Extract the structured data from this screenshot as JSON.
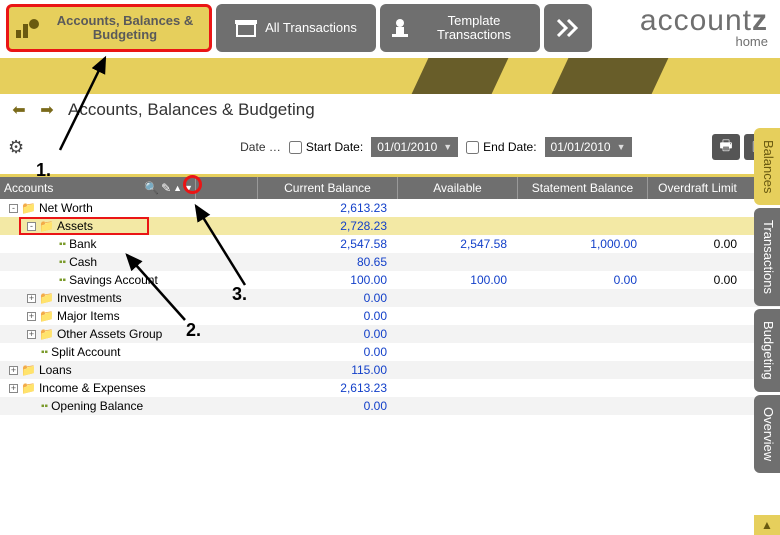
{
  "toolbar": {
    "accounts_label": "Accounts, Balances & Budgeting",
    "all_trans_label": "All Transactions",
    "template_trans_label": "Template Transactions"
  },
  "brand": {
    "name_a": "account",
    "name_b": "z",
    "sub": "home"
  },
  "page": {
    "title": "Accounts, Balances & Budgeting"
  },
  "filter": {
    "date_label": "Date …",
    "start_label": "Start Date:",
    "end_label": "End Date:",
    "start_value": "01/01/2010",
    "end_value": "01/01/2010"
  },
  "columns": {
    "tree": "Accounts",
    "current": "Current Balance",
    "available": "Available",
    "statement": "Statement Balance",
    "overdraft": "Overdraft Limit"
  },
  "rows": [
    {
      "indent": 0,
      "exp": "-",
      "icon": "folder",
      "label": "Net Worth",
      "cb": "2,613.23",
      "av": "",
      "sb": "",
      "ol": ""
    },
    {
      "indent": 1,
      "exp": "-",
      "icon": "folder",
      "label": "Assets",
      "cb": "2,728.23",
      "av": "",
      "sb": "",
      "ol": "",
      "selected": true,
      "boxed": true
    },
    {
      "indent": 2,
      "exp": "",
      "icon": "leaf",
      "label": "Bank",
      "cb": "2,547.58",
      "av": "2,547.58",
      "sb": "1,000.00",
      "ol": "0.00"
    },
    {
      "indent": 2,
      "exp": "",
      "icon": "leaf",
      "label": "Cash",
      "cb": "80.65",
      "av": "",
      "sb": "",
      "ol": ""
    },
    {
      "indent": 2,
      "exp": "",
      "icon": "leaf",
      "label": "Savings Account",
      "cb": "100.00",
      "av": "100.00",
      "sb": "0.00",
      "ol": "0.00"
    },
    {
      "indent": 1,
      "exp": "+",
      "icon": "folder",
      "label": "Investments",
      "cb": "0.00",
      "av": "",
      "sb": "",
      "ol": ""
    },
    {
      "indent": 1,
      "exp": "+",
      "icon": "folder",
      "label": "Major Items",
      "cb": "0.00",
      "av": "",
      "sb": "",
      "ol": ""
    },
    {
      "indent": 1,
      "exp": "+",
      "icon": "folder",
      "label": "Other Assets Group",
      "cb": "0.00",
      "av": "",
      "sb": "",
      "ol": ""
    },
    {
      "indent": 1,
      "exp": "",
      "icon": "leaf",
      "label": "Split Account",
      "cb": "0.00",
      "av": "",
      "sb": "",
      "ol": ""
    },
    {
      "indent": 0,
      "exp": "+",
      "icon": "folder",
      "label": "Loans",
      "cb": "115.00",
      "av": "",
      "sb": "",
      "ol": ""
    },
    {
      "indent": 0,
      "exp": "+",
      "icon": "folder",
      "label": "Income & Expenses",
      "cb": "2,613.23",
      "av": "",
      "sb": "",
      "ol": ""
    },
    {
      "indent": 1,
      "exp": "",
      "icon": "leaf",
      "label": "Opening Balance",
      "cb": "0.00",
      "av": "",
      "sb": "",
      "ol": ""
    }
  ],
  "side_tabs": {
    "balances": "Balances",
    "transactions": "Transactions",
    "budgeting": "Budgeting",
    "overview": "Overview"
  },
  "annotations": {
    "a1": "1.",
    "a2": "2.",
    "a3": "3."
  }
}
